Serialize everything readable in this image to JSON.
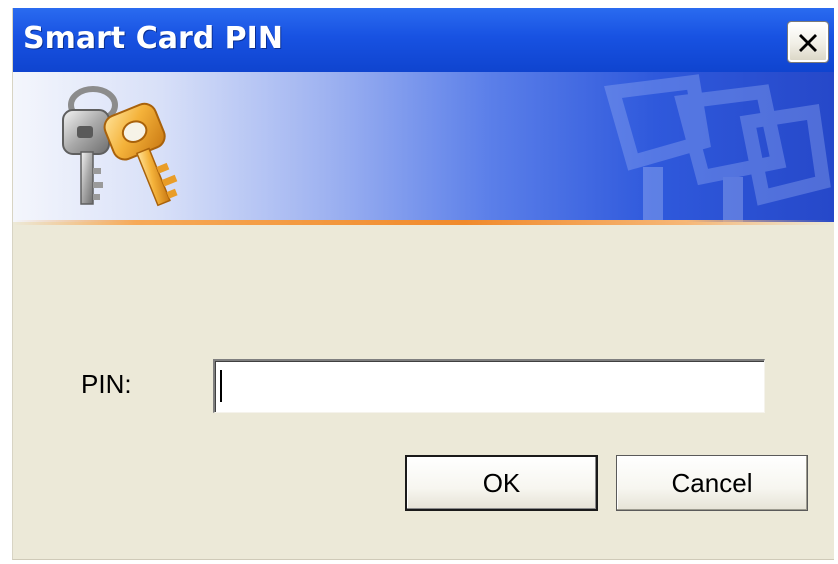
{
  "window": {
    "title": "Smart Card PIN",
    "close_symbol": "×"
  },
  "banner": {
    "logo_icon": "keys-icon",
    "watermark_icon": "keys-watermark-icon"
  },
  "form": {
    "pin_label": "PIN:",
    "pin_value": ""
  },
  "buttons": {
    "ok_label": "OK",
    "cancel_label": "Cancel"
  },
  "colors": {
    "title_bar": "#1852e2",
    "dialog_background": "#ece9d8",
    "banner_accent": "#f08a2c"
  }
}
